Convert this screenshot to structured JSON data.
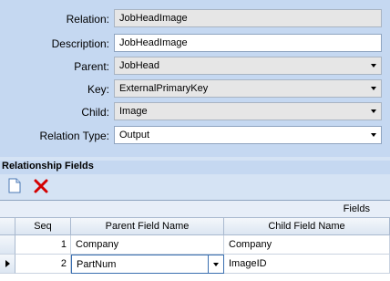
{
  "form": {
    "relation": {
      "label": "Relation:",
      "value": "JobHeadImage"
    },
    "description": {
      "label": "Description:",
      "value": "JobHeadImage"
    },
    "parent": {
      "label": "Parent:",
      "value": "JobHead"
    },
    "key": {
      "label": "Key:",
      "value": "ExternalPrimaryKey"
    },
    "child": {
      "label": "Child:",
      "value": "Image"
    },
    "relation_type": {
      "label": "Relation Type:",
      "value": "Output"
    }
  },
  "relationship_fields": {
    "title": "Relationship Fields",
    "toolbar": {
      "new_icon": "new-document-icon",
      "delete_icon": "delete-x-icon"
    },
    "grid": {
      "banner": "Fields",
      "columns": [
        "Seq",
        "Parent Field Name",
        "Child Field Name"
      ],
      "rows": [
        {
          "seq": "1",
          "parent": "Company",
          "child": "Company"
        },
        {
          "seq": "2",
          "parent": "PartNum",
          "child": "ImageID"
        }
      ]
    }
  },
  "colors": {
    "background": "#c5d8f1",
    "readonly": "#e6e6e6",
    "delete": "#d40000"
  }
}
